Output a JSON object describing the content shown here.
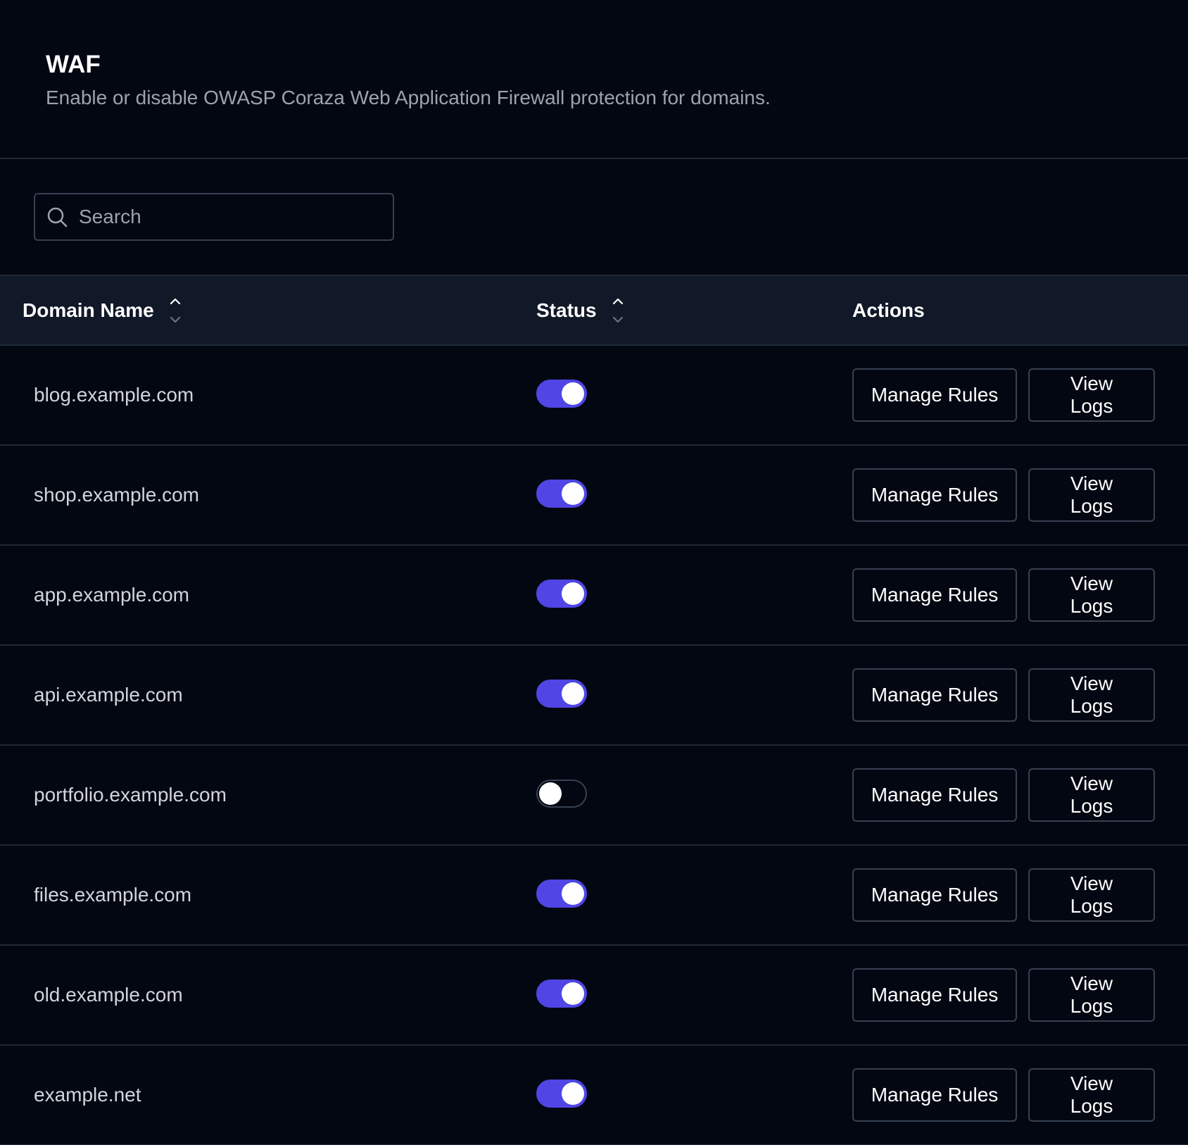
{
  "header": {
    "title": "WAF",
    "subtitle": "Enable or disable OWASP Coraza Web Application Firewall protection for domains."
  },
  "search": {
    "placeholder": "Search",
    "value": ""
  },
  "table": {
    "columns": {
      "domain": "Domain Name",
      "status": "Status",
      "actions": "Actions"
    },
    "rows": [
      {
        "domain": "blog.example.com",
        "enabled": true,
        "manage_label": "Manage Rules",
        "logs_label": "View Logs"
      },
      {
        "domain": "shop.example.com",
        "enabled": true,
        "manage_label": "Manage Rules",
        "logs_label": "View Logs"
      },
      {
        "domain": "app.example.com",
        "enabled": true,
        "manage_label": "Manage Rules",
        "logs_label": "View Logs"
      },
      {
        "domain": "api.example.com",
        "enabled": true,
        "manage_label": "Manage Rules",
        "logs_label": "View Logs"
      },
      {
        "domain": "portfolio.example.com",
        "enabled": false,
        "manage_label": "Manage Rules",
        "logs_label": "View Logs"
      },
      {
        "domain": "files.example.com",
        "enabled": true,
        "manage_label": "Manage Rules",
        "logs_label": "View Logs"
      },
      {
        "domain": "old.example.com",
        "enabled": true,
        "manage_label": "Manage Rules",
        "logs_label": "View Logs"
      },
      {
        "domain": "example.net",
        "enabled": true,
        "manage_label": "Manage Rules",
        "logs_label": "View Logs"
      }
    ]
  },
  "colors": {
    "background": "#030712",
    "header_row": "#111827",
    "accent": "#4f46e5",
    "border": "#1f2937"
  },
  "icons": {
    "search": "search-icon",
    "sort": "sort-icon"
  }
}
